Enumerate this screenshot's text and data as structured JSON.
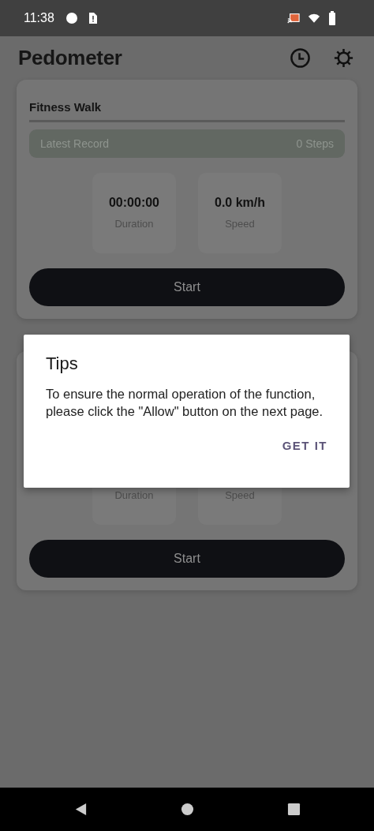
{
  "status_bar": {
    "time": "11:38"
  },
  "app_bar": {
    "title": "Pedometer"
  },
  "cards": [
    {
      "title": "Fitness Walk",
      "record_label": "Latest Record",
      "record_value": "0 Steps",
      "stats": [
        {
          "value": "00:00:00",
          "label": "Duration"
        },
        {
          "value": "0.0 km/h",
          "label": "Speed"
        }
      ],
      "button": "Start"
    },
    {
      "stats": [
        {
          "label": "Duration"
        },
        {
          "label": "Speed"
        }
      ],
      "button": "Start"
    }
  ],
  "dialog": {
    "title": "Tips",
    "message": "To ensure the normal operation of the function, please click the \"Allow\" button on the next page.",
    "button": "GET IT"
  }
}
